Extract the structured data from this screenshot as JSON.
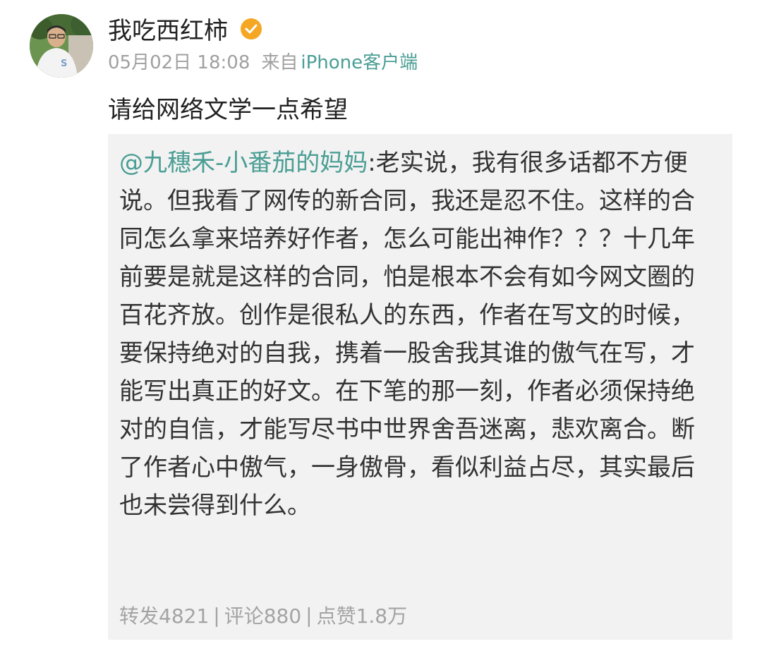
{
  "post": {
    "author": "我吃西红柿",
    "time": "05月02日 18:08",
    "source_prefix": "来自",
    "source": "iPhone客户端",
    "text": "请给网络文学一点希望"
  },
  "repost": {
    "mention": "@九穗禾-小番茄的妈妈",
    "text": ":老实说，我有很多话都不方便说。但我看了网传的新合同，我还是忍不住。这样的合同怎么拿来培养好作者，怎么可能出神作？？？十几年前要是就是这样的合同，怕是根本不会有如今网文圈的百花齐放。创作是很私人的东西，作者在写文的时候，要保持绝对的自我，携着一股舍我其谁的傲气在写，才能写出真正的好文。在下笔的那一刻，作者必须保持绝对的自信，才能写尽书中世界舍吾迷离，悲欢离合。断了作者心中傲气，一身傲骨，看似利益占尽，其实最后也未尝得到什么。",
    "stats": {
      "repost": "转发4821",
      "comment": "评论880",
      "like": "点赞1.8万",
      "separator": "|"
    }
  },
  "colors": {
    "link": "#4a9e94",
    "meta": "#a0a0a0",
    "verified_badge": "#f5a623",
    "repost_background": "#f2f2f2"
  },
  "icons": {
    "verified": "verified-badge-icon"
  }
}
